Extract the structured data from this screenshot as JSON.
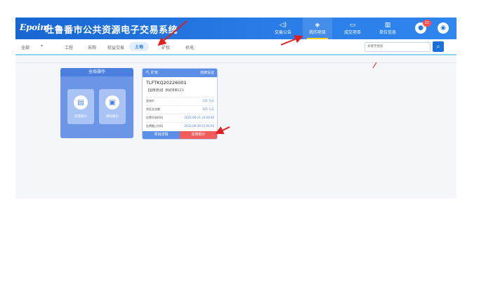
{
  "header": {
    "logo": "Epoint",
    "title": "吐鲁番市公共资源电子交易系统",
    "nav": [
      {
        "label": "交易公告",
        "icon": "speaker-icon"
      },
      {
        "label": "我的项目",
        "icon": "layers-icon",
        "active": true
      },
      {
        "label": "成交项目",
        "icon": "screen-icon"
      },
      {
        "label": "单位信息",
        "icon": "building-icon"
      }
    ],
    "notification_count": "21",
    "accent": "#2a7de6"
  },
  "subbar": {
    "filter": "全部",
    "tabs": [
      "工程",
      "采购",
      "权益交易",
      "土地",
      "矿权",
      "机电"
    ],
    "active_tab": "土地",
    "search_placeholder": "关键字搜索"
  },
  "ops_panel": {
    "title": "全局操作",
    "buttons": [
      {
        "label": "批量报价",
        "icon": "batch-quote-icon"
      },
      {
        "label": "模拟报价",
        "icon": "simulate-quote-icon"
      }
    ]
  },
  "project_card": {
    "type": "矿权",
    "status": "挂牌设证",
    "code": "TLFTKQ20226001",
    "name": "【国德测试】测试项目121",
    "rows": [
      {
        "key": "起始价",
        "value": "231 万元"
      },
      {
        "key": "保证金金额",
        "value": "321 万元"
      },
      {
        "key": "挂牌开始时间",
        "value": "2022-06-21 10:00:00"
      },
      {
        "key": "挂牌截止时间",
        "value": "2022-06-30 22:00:00"
      }
    ],
    "detail_label": "项目详情",
    "bid_label": "挂牌报价",
    "bid_color": "#f15b5b"
  }
}
